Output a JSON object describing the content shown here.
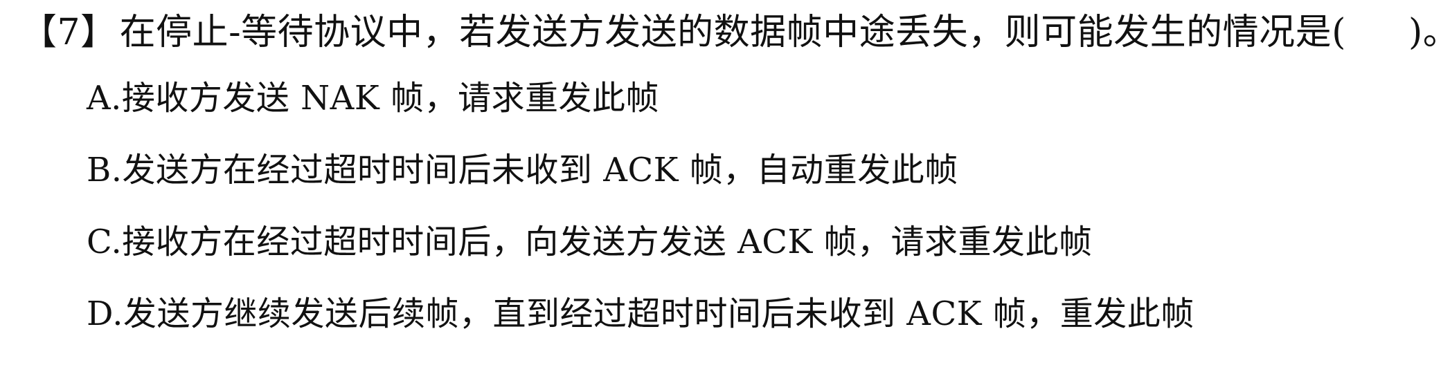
{
  "question": {
    "number_text": "【7】",
    "stem_before_blank": "在停止-等待协议中，若发送方发送的数据帧中途丢失，则可能发生的情况是(",
    "stem_after_blank": ")。",
    "options": [
      "A.接收方发送 NAK 帧，请求重发此帧",
      "B.发送方在经过超时时间后未收到 ACK 帧，自动重发此帧",
      "C.接收方在经过超时时间后，向发送方发送 ACK 帧，请求重发此帧",
      "D.发送方继续发送后续帧，直到经过超时时间后未收到 ACK 帧，重发此帧"
    ]
  }
}
